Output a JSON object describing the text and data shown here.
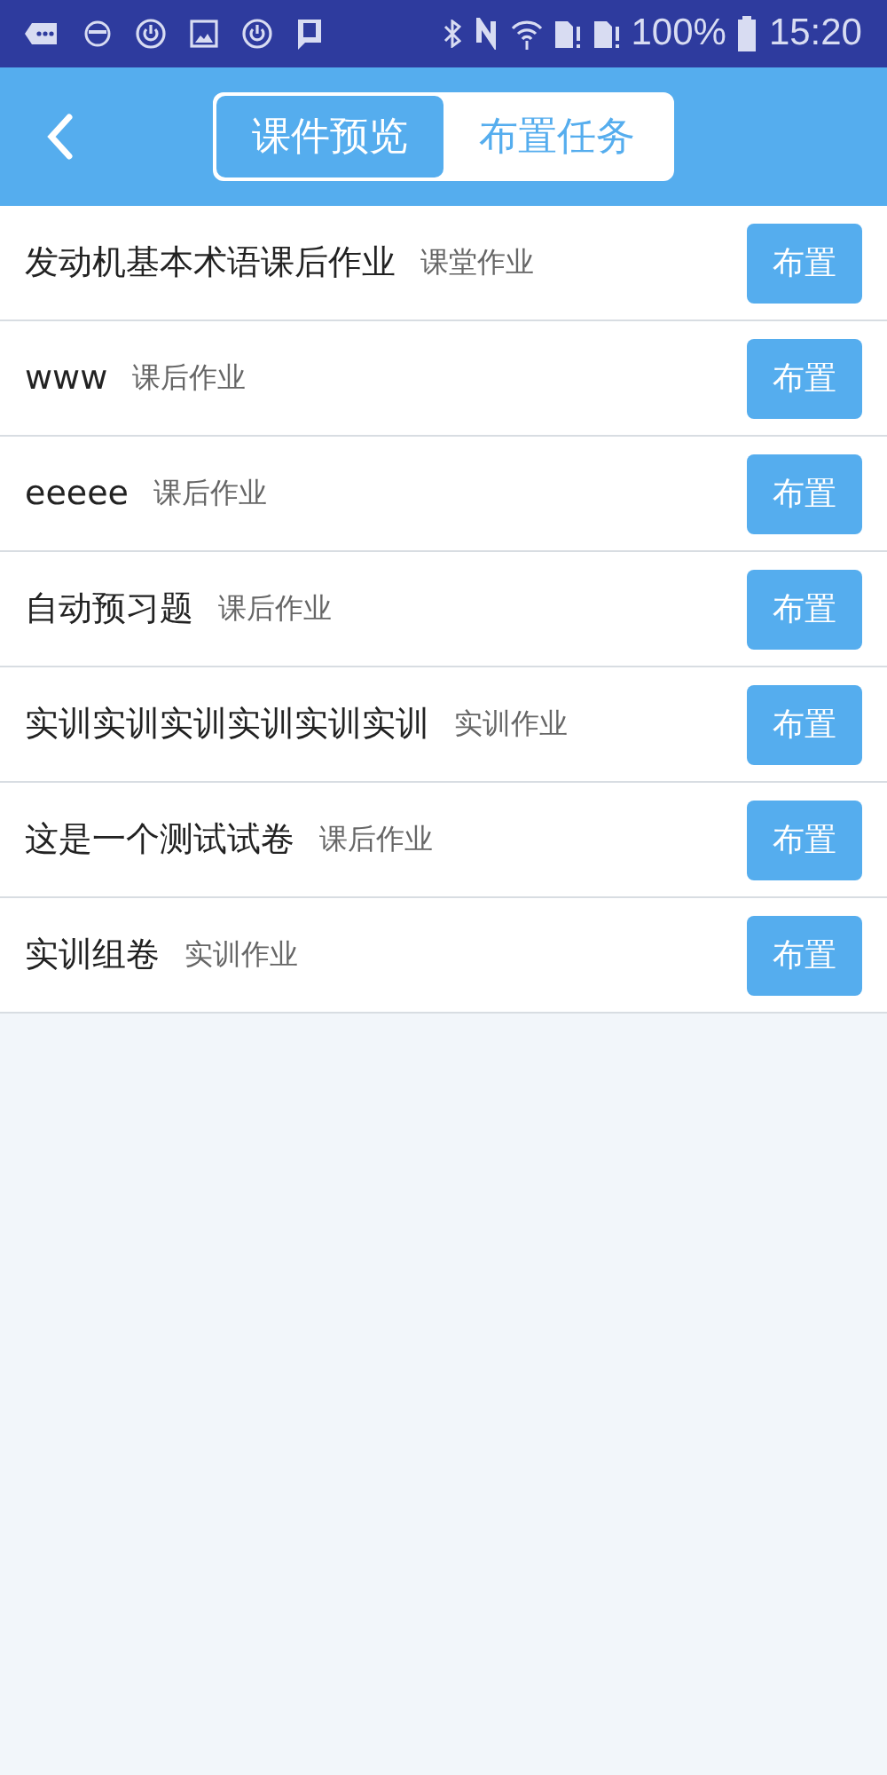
{
  "status_bar": {
    "battery": "100%",
    "time": "15:20"
  },
  "tabs": [
    {
      "label": "课件预览",
      "selected": true
    },
    {
      "label": "布置任务",
      "selected": false
    }
  ],
  "tasks": [
    {
      "title": "发动机基本术语课后作业",
      "type": "课堂作业",
      "button": "布置"
    },
    {
      "title": "www",
      "type": "课后作业",
      "button": "布置"
    },
    {
      "title": "eeeee",
      "type": "课后作业",
      "button": "布置"
    },
    {
      "title": "自动预习题",
      "type": "课后作业",
      "button": "布置"
    },
    {
      "title": "实训实训实训实训实训实训",
      "type": "实训作业",
      "button": "布置"
    },
    {
      "title": "这是一个测试试卷",
      "type": "课后作业",
      "button": "布置"
    },
    {
      "title": "实训组卷",
      "type": "实训作业",
      "button": "布置"
    }
  ]
}
